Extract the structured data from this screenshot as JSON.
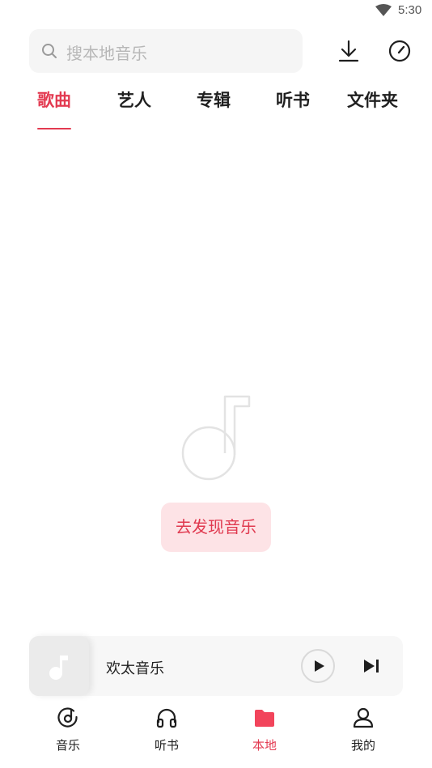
{
  "status_bar": {
    "time": "5:30",
    "wifi_icon": "wifi-icon"
  },
  "search": {
    "placeholder": "搜本地音乐"
  },
  "header_actions": {
    "download_icon": "download-icon",
    "speed_icon": "speedometer-icon"
  },
  "tabs": [
    {
      "label": "歌曲",
      "active": true
    },
    {
      "label": "艺人",
      "active": false
    },
    {
      "label": "专辑",
      "active": false
    },
    {
      "label": "听书",
      "active": false
    },
    {
      "label": "文件夹",
      "active": false
    }
  ],
  "empty_state": {
    "icon": "music-note-icon",
    "button_label": "去发现音乐"
  },
  "mini_player": {
    "title": "欢太音乐",
    "play_icon": "play-icon",
    "next_icon": "skip-next-icon"
  },
  "bottom_nav": [
    {
      "label": "音乐",
      "icon": "music-disc-icon",
      "active": false
    },
    {
      "label": "听书",
      "icon": "headphones-icon",
      "active": false
    },
    {
      "label": "本地",
      "icon": "folder-icon",
      "active": true
    },
    {
      "label": "我的",
      "icon": "profile-icon",
      "active": false
    }
  ],
  "colors": {
    "accent": "#e33a51",
    "button_bg": "#fde3e6",
    "search_bg": "#f5f5f5"
  }
}
